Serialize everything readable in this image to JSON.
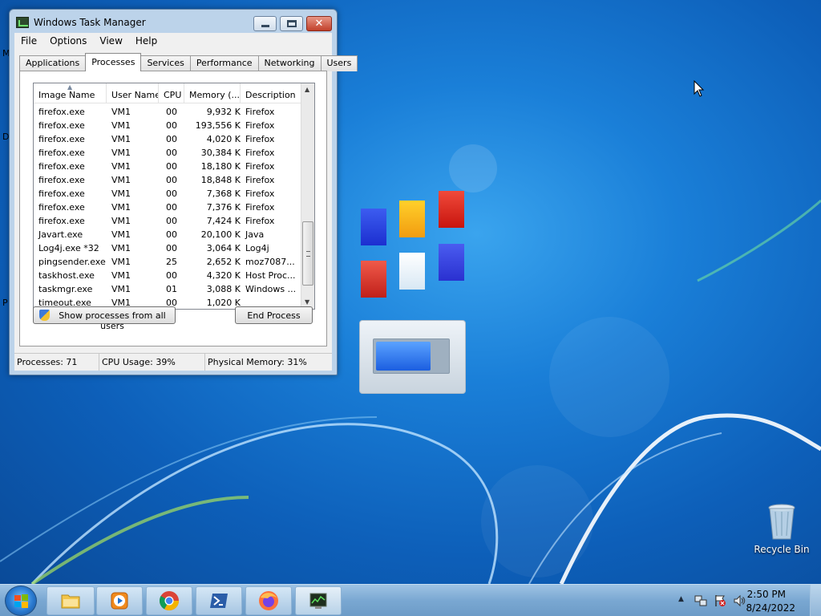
{
  "desktop": {
    "left_edge_letters": [
      "M",
      "D",
      "P"
    ],
    "recycle_bin_label": "Recycle Bin"
  },
  "window": {
    "title": "Windows Task Manager",
    "close_glyph": "✕",
    "menu": [
      "File",
      "Options",
      "View",
      "Help"
    ],
    "tabs": [
      "Applications",
      "Processes",
      "Services",
      "Performance",
      "Networking",
      "Users"
    ],
    "active_tab": "Processes",
    "columns": [
      "Image Name",
      "User Name",
      "CPU",
      "Memory (...",
      "Description"
    ],
    "processes": [
      {
        "name": "firefox.exe",
        "user": "VM1",
        "cpu": "00",
        "memory": "9,932 K",
        "description": "Firefox"
      },
      {
        "name": "firefox.exe",
        "user": "VM1",
        "cpu": "00",
        "memory": "193,556 K",
        "description": "Firefox"
      },
      {
        "name": "firefox.exe",
        "user": "VM1",
        "cpu": "00",
        "memory": "4,020 K",
        "description": "Firefox"
      },
      {
        "name": "firefox.exe",
        "user": "VM1",
        "cpu": "00",
        "memory": "30,384 K",
        "description": "Firefox"
      },
      {
        "name": "firefox.exe",
        "user": "VM1",
        "cpu": "00",
        "memory": "18,180 K",
        "description": "Firefox"
      },
      {
        "name": "firefox.exe",
        "user": "VM1",
        "cpu": "00",
        "memory": "18,848 K",
        "description": "Firefox"
      },
      {
        "name": "firefox.exe",
        "user": "VM1",
        "cpu": "00",
        "memory": "7,368 K",
        "description": "Firefox"
      },
      {
        "name": "firefox.exe",
        "user": "VM1",
        "cpu": "00",
        "memory": "7,376 K",
        "description": "Firefox"
      },
      {
        "name": "firefox.exe",
        "user": "VM1",
        "cpu": "00",
        "memory": "7,424 K",
        "description": "Firefox"
      },
      {
        "name": "Javart.exe",
        "user": "VM1",
        "cpu": "00",
        "memory": "20,100 K",
        "description": "Java"
      },
      {
        "name": "Log4j.exe *32",
        "user": "VM1",
        "cpu": "00",
        "memory": "3,064 K",
        "description": "Log4j"
      },
      {
        "name": "pingsender.exe",
        "user": "VM1",
        "cpu": "25",
        "memory": "2,652 K",
        "description": "moz7087..."
      },
      {
        "name": "taskhost.exe",
        "user": "VM1",
        "cpu": "00",
        "memory": "4,320 K",
        "description": "Host Proc..."
      },
      {
        "name": "taskmgr.exe",
        "user": "VM1",
        "cpu": "01",
        "memory": "3,088 K",
        "description": "Windows ..."
      },
      {
        "name": "timeout.exe",
        "user": "VM1",
        "cpu": "00",
        "memory": "1,020 K",
        "description": ""
      }
    ],
    "show_all_button": "Show processes from all users",
    "end_process_button": "End Process",
    "status": {
      "processes": "Processes: 71",
      "cpu": "CPU Usage: 39%",
      "memory": "Physical Memory: 31%"
    }
  },
  "taskbar": {
    "pinned_icons": [
      "folder-icon",
      "media-player-icon",
      "chrome-icon",
      "powershell-icon",
      "firefox-icon",
      "task-manager-icon"
    ],
    "clock_time": "2:50 PM",
    "clock_date": "8/24/2022",
    "tray_arrow": "▲"
  }
}
